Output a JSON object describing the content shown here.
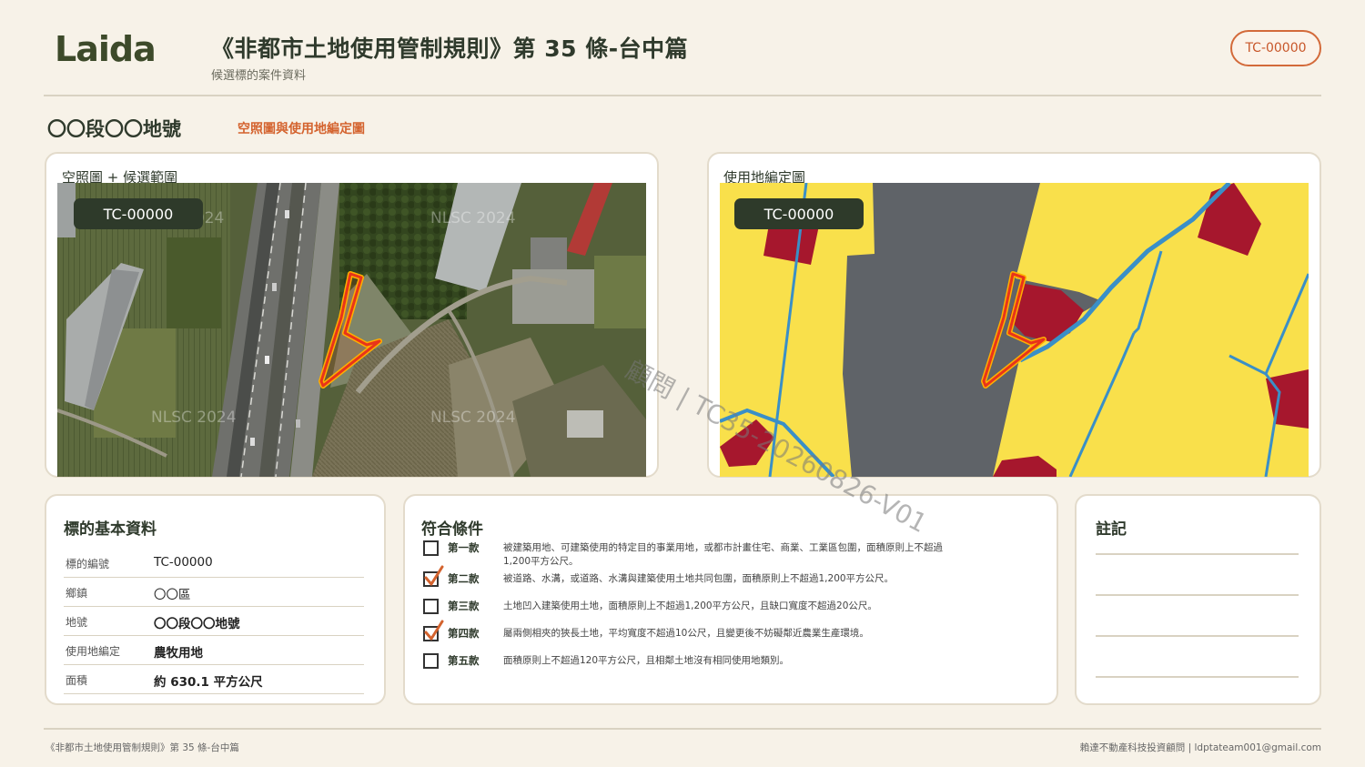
{
  "header": {
    "logo": "Laida",
    "title": "《非都市土地使用管制規則》第 35 條-台中篇",
    "subtitle": "候選標的案件資料",
    "case_id": "TC-00000"
  },
  "parcel": {
    "name": "〇〇段〇〇地號",
    "section_link": "空照圖與使用地編定圖"
  },
  "maps": {
    "aerial": {
      "label": "空照圖 + 候選範圍",
      "chip": "TC-00000",
      "watermark_text": "NLSC 2024"
    },
    "zoning": {
      "label": "使用地編定圖",
      "chip": "TC-00000"
    }
  },
  "basic_info": {
    "title": "標的基本資料",
    "rows": [
      {
        "key": "標的編號",
        "value": "TC-00000"
      },
      {
        "key": "鄉鎮",
        "value": "〇〇區"
      },
      {
        "key": "地號",
        "value": "〇〇段〇〇地號"
      },
      {
        "key": "使用地編定",
        "value": "農牧用地"
      },
      {
        "key": "面積",
        "value": "約 630.1 平方公尺"
      }
    ]
  },
  "conditions": {
    "title": "符合條件",
    "items": [
      {
        "name": "第一款",
        "checked": false,
        "desc": "被建築用地、可建築使用的特定目的事業用地，或都市計畫住宅、商業、工業區包圍，面積原則上不超過1,200平方公尺。"
      },
      {
        "name": "第二款",
        "checked": true,
        "desc": "被道路、水溝，或道路、水溝與建築使用土地共同包圍，面積原則上不超過1,200平方公尺。"
      },
      {
        "name": "第三款",
        "checked": false,
        "desc": "土地凹入建築使用土地，面積原則上不超過1,200平方公尺，且缺口寬度不超過20公尺。"
      },
      {
        "name": "第四款",
        "checked": true,
        "desc": "屬兩側相夾的狹長土地，平均寬度不超過10公尺，且變更後不妨礙鄰近農業生產環境。"
      },
      {
        "name": "第五款",
        "checked": false,
        "desc": "面積原則上不超過120平方公尺，且相鄰土地沒有相同使用地類別。"
      }
    ]
  },
  "notes": {
    "title": "註記"
  },
  "watermark": "顧問 | TC35-20260826-V01",
  "footer": {
    "left": "《非都市土地使用管制規則》第 35 條-台中篇",
    "right": "賴達不動產科技投資顧問 | ldptateam001@gmail.com"
  },
  "colors": {
    "accent": "#d4632e",
    "dark": "#2e3a2a",
    "background": "#f7f2e8",
    "zoning_yellow": "#f9e04b",
    "zoning_gray": "#5f6368",
    "zoning_red": "#a6172d",
    "zoning_blue": "#3a8fc7"
  }
}
